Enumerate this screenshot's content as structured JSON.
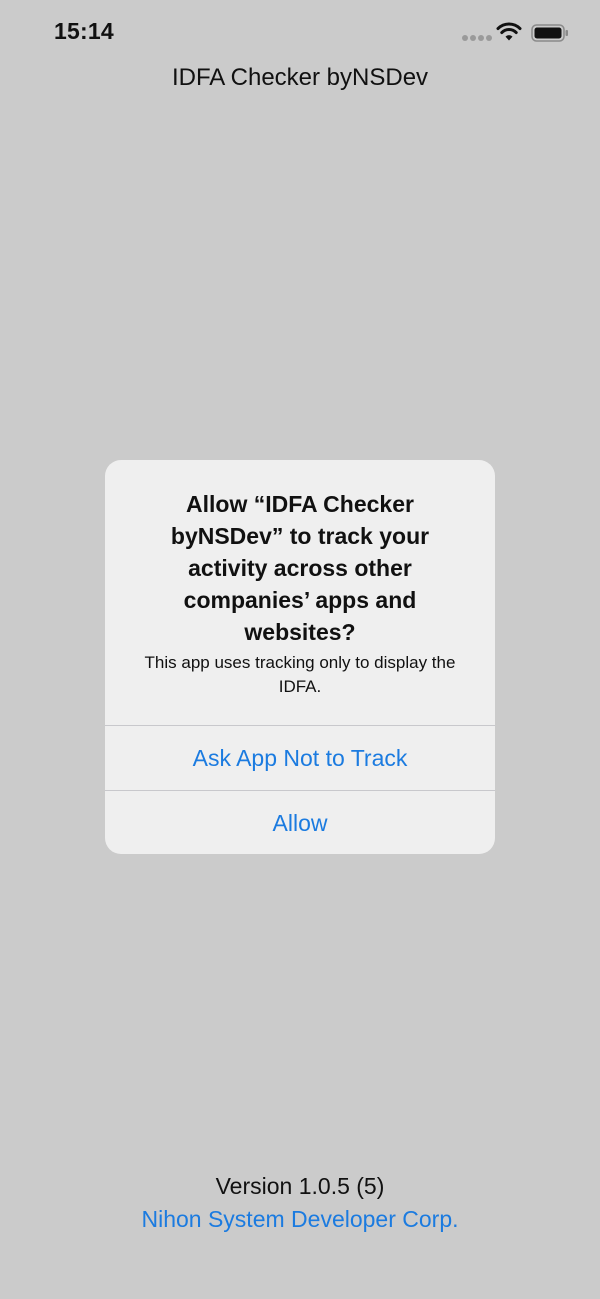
{
  "status_bar": {
    "time": "15:14",
    "icons": [
      "signal-dots-icon",
      "wifi-icon",
      "battery-icon"
    ]
  },
  "app": {
    "title": "IDFA Checker byNSDev"
  },
  "alert": {
    "title": "Allow “IDFA Checker byNSDev” to track your activity across other companies’ apps and websites?",
    "message": "This app uses tracking only to display the IDFA.",
    "buttons": [
      {
        "label": "Ask App Not to Track"
      },
      {
        "label": "Allow"
      }
    ]
  },
  "footer": {
    "version": "Version 1.0.5 (5)",
    "company": "Nihon System Developer Corp."
  },
  "colors": {
    "background": "#cbcbcb",
    "alert_background": "#efefef",
    "accent_blue": "#1b7be0"
  }
}
